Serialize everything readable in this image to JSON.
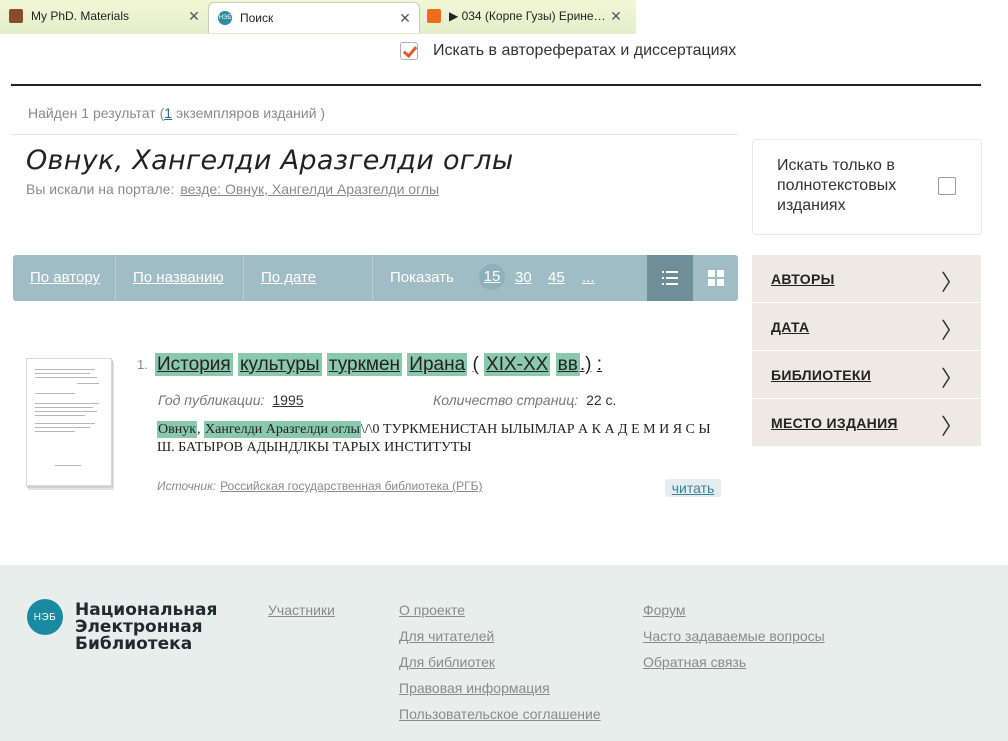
{
  "browser": {
    "tabs": [
      {
        "label": "My PhD. Materials",
        "icon": "bookmark-icon"
      },
      {
        "label": "Поиск",
        "icon": "neb-icon",
        "icon_text": "НЭБ"
      },
      {
        "label": "▶ 034 (Корпе Гузы) Ерине…",
        "icon": "soundcloud-icon"
      }
    ],
    "close_glyph": "✕"
  },
  "search_options": {
    "abstracts_label": "Искать в авторефератах и диссертациях",
    "abstracts_checked": true,
    "fulltext_label": "Искать только в полнотекстовых изданиях",
    "fulltext_checked": false
  },
  "results_summary": {
    "prefix": "Найден 1 результат (",
    "copies_count": "1",
    "suffix": "экземпляров изданий )"
  },
  "query": {
    "title": "Овнук, Хангелди Аразгелди оглы",
    "searched_label": "Вы искали на портале:",
    "searched_link": "везде: Овнук, Хангелди Аразгелди оглы"
  },
  "sortbar": {
    "by_author": "По автору",
    "by_title": "По названию",
    "by_date": "По дате",
    "show_label": "Показать",
    "page_sizes": [
      "15",
      "30",
      "45",
      "..."
    ],
    "selected_page_size": "15",
    "view_modes": [
      "list-view-icon",
      "grid-view-icon"
    ]
  },
  "facets": [
    {
      "label": "АВТОРЫ"
    },
    {
      "label": "ДАТА"
    },
    {
      "label": "БИБЛИОТЕКИ"
    },
    {
      "label": "МЕСТО ИЗДАНИЯ"
    }
  ],
  "facet_chevron": "〉",
  "results": [
    {
      "number": "1.",
      "title_words": [
        "История",
        "культуры",
        "туркмен",
        "Ирана",
        "(",
        "XIX-XX",
        "вв",
        ".)",
        ":"
      ],
      "year_label": "Год публикации:",
      "year": "1995",
      "pages_label": "Количество страниц:",
      "pages": "22 с.",
      "author_hl_1": "Овнук",
      "author_sep": ",",
      "author_hl_2": "Хангелди Аразгелди оглы",
      "description_rest": "\\/\\0 ТУРКМЕНИСТАН ЫЛЫМЛАР А К А Д Е М И Я С Ы Ш. БАТЫРОВ АДЫНДЛКЫ ТАРЫХ ИНСТИТУТЫ",
      "source_label": "Источник:",
      "source": "Российская государственная библиотека (РГБ)",
      "read_label": "читать"
    }
  ],
  "footer": {
    "logo_mark": "НЭБ",
    "logo_lines": [
      "Национальная",
      "Электронная",
      "Библиотека"
    ],
    "col1": [
      "Участники"
    ],
    "col2": [
      "О проекте",
      "Для читателей",
      "Для библиотек",
      "Правовая информация",
      "Пользовательское соглашение"
    ],
    "col3": [
      "Форум",
      "Часто задаваемые вопросы",
      "Обратная связь"
    ]
  },
  "colors": {
    "accent_teal": "#1a8aa1",
    "highlight": "#8ac9ad",
    "sortbar": "#a0bcc4",
    "checkbox_orange": "#e2582a",
    "facet_bg": "#eee9e3",
    "footer_bg": "#e8eeec"
  }
}
